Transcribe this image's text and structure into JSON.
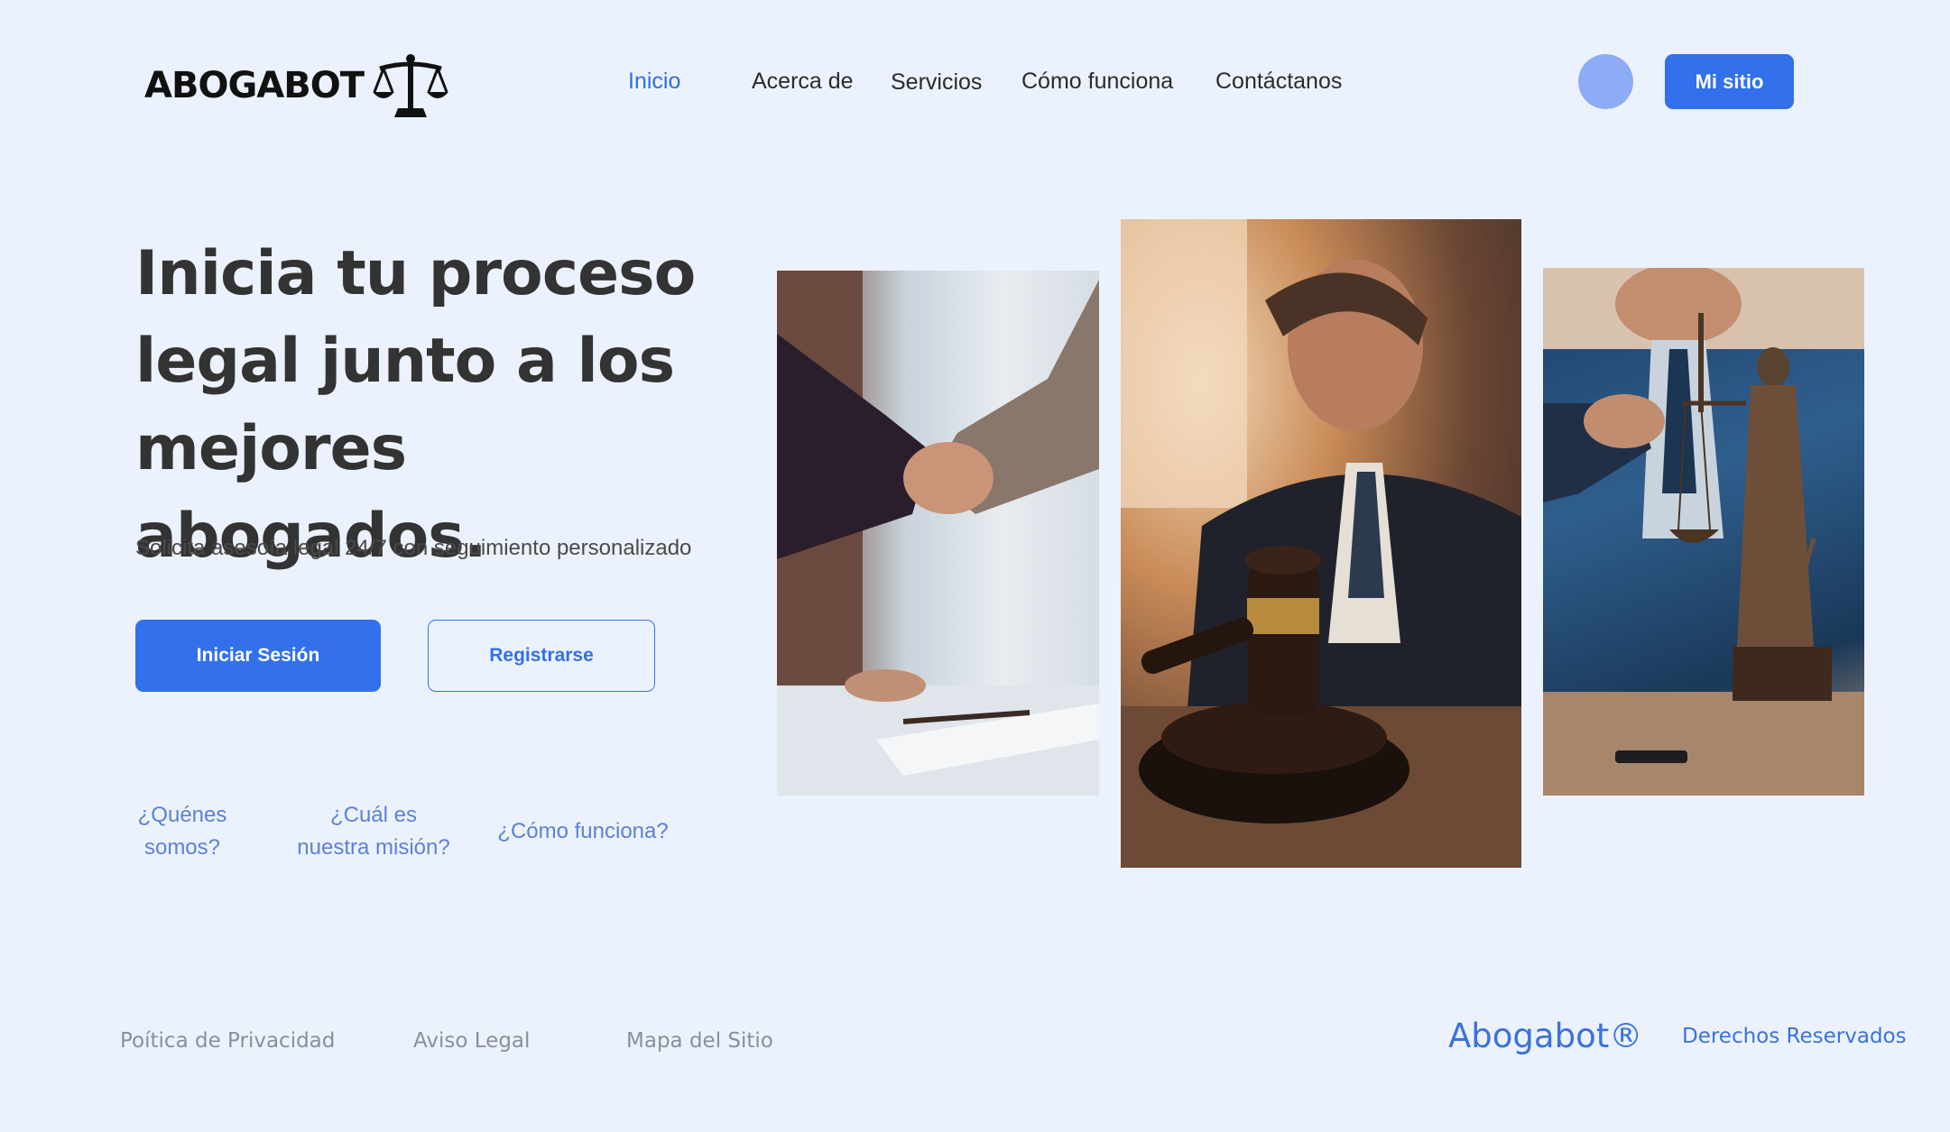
{
  "brand": {
    "logo_text": "ABOGABOT",
    "logo_icon": "scales-of-justice-icon"
  },
  "nav": {
    "items": [
      {
        "label": "Inicio",
        "active": true
      },
      {
        "label": "Acerca de",
        "active": false
      },
      {
        "label": "Servicios",
        "active": false
      },
      {
        "label": "Cómo funciona",
        "active": false
      },
      {
        "label": "Contáctanos",
        "active": false
      }
    ],
    "mysite_label": "Mi sitio"
  },
  "hero": {
    "title": "Inicia tu proceso legal junto a los mejores abogados.",
    "subtitle": "Solicita asesoía legal 24/7 con seguimiento personalizado",
    "login_label": "Iniciar Sesión",
    "register_label": "Registrarse"
  },
  "faq": {
    "q1_line1": "¿Quénes",
    "q1_line2": "somos?",
    "q2_line1": "¿Cuál es",
    "q2_line2": "nuestra misión?",
    "q3": "¿Cómo funciona?"
  },
  "footer": {
    "privacy": "Poítica de Privacidad",
    "legal": "Aviso Legal",
    "sitemap": "Mapa del Sitio",
    "brand": "Abogabot®",
    "rights": "Derechos Reservados"
  },
  "colors": {
    "accent": "#3270ec",
    "background": "#ecf2fd",
    "avatar": "#8eacf6",
    "link": "#5b82d6"
  }
}
